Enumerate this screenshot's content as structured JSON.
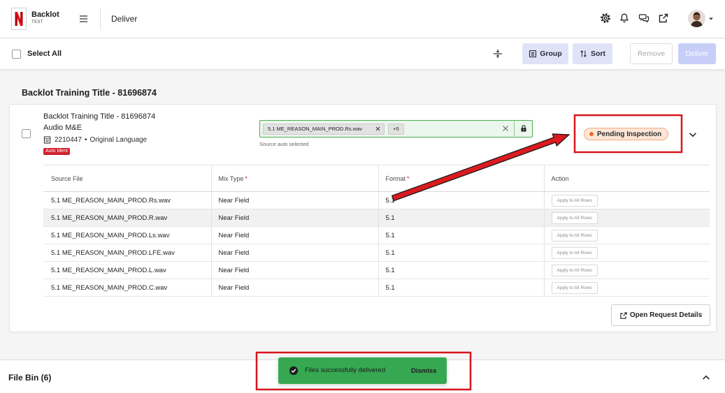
{
  "header": {
    "logo_letter": "N",
    "app_name": "Backlot",
    "env": "TEST",
    "page_title": "Deliver"
  },
  "toolbar": {
    "select_all": "Select All",
    "group": "Group",
    "sort": "Sort",
    "remove": "Remove",
    "deliver": "Deliver"
  },
  "section": {
    "title": "Backlot Training Title - 81696874"
  },
  "card": {
    "title": "Backlot Training Title - 81696874",
    "subtitle": "Audio M&E",
    "meta_id": "2210447",
    "meta_separator": "•",
    "meta_language": "Original Language",
    "badge": "Auto Ident",
    "source_select": {
      "chip": "5.1 ME_REASON_MAIN_PROD.Rs.wav",
      "more": "+5",
      "helper": "Source auto selected"
    },
    "status": "Pending Inspection",
    "table": {
      "columns": [
        {
          "label": "Source File"
        },
        {
          "label": "Mix Type",
          "required": "*"
        },
        {
          "label": "Format",
          "required": "*"
        },
        {
          "label": "Action"
        }
      ],
      "rows": [
        {
          "source": "5.1 ME_REASON_MAIN_PROD.Rs.wav",
          "mix": "Near Field",
          "format": "5.1",
          "action": "Apply to All Rows"
        },
        {
          "source": "5.1 ME_REASON_MAIN_PROD.R.wav",
          "mix": "Near Field",
          "format": "5.1",
          "action": "Apply to All Rows"
        },
        {
          "source": "5.1 ME_REASON_MAIN_PROD.Ls.wav",
          "mix": "Near Field",
          "format": "5.1",
          "action": "Apply to All Rows"
        },
        {
          "source": "5.1 ME_REASON_MAIN_PROD.LFE.wav",
          "mix": "Near Field",
          "format": "5.1",
          "action": "Apply to All Rows"
        },
        {
          "source": "5.1 ME_REASON_MAIN_PROD.L.wav",
          "mix": "Near Field",
          "format": "5.1",
          "action": "Apply to All Rows"
        },
        {
          "source": "5.1 ME_REASON_MAIN_PROD.C.wav",
          "mix": "Near Field",
          "format": "5.1",
          "action": "Apply to All Rows"
        }
      ]
    },
    "open_details": "Open Request Details"
  },
  "file_bin": {
    "label": "File Bin (6)"
  },
  "toast": {
    "message": "Files successfully delivered",
    "action": "Dismiss"
  },
  "icons": {
    "menu": "menu-icon",
    "settings": "gear-icon",
    "notifications": "bell-icon",
    "messages": "chat-icon",
    "open_external": "external-link-icon",
    "account_menu": "chevron-down-icon",
    "collapse_filter": "filter-icon",
    "group": "list-icon",
    "sort": "sort-icon",
    "remove_chip": "close-icon",
    "clear": "close-icon",
    "lock": "lock-icon",
    "meta": "document-icon",
    "expand": "chevron-down-icon",
    "file_bin_toggle": "chevron-up-icon",
    "toast_status": "check-circle-icon"
  },
  "colors": {
    "brand_red": "#e50914",
    "primary_light": "#dfe3f8",
    "deliver_disabled": "#c7cff9",
    "source_border": "#4caf50",
    "source_bg": "#ebf6ec",
    "status_dot": "#f26a21",
    "status_bg": "#fde6d8",
    "badge_red": "#d0202e",
    "toast_green": "#36a852",
    "annotation_red": "#d8141b"
  }
}
